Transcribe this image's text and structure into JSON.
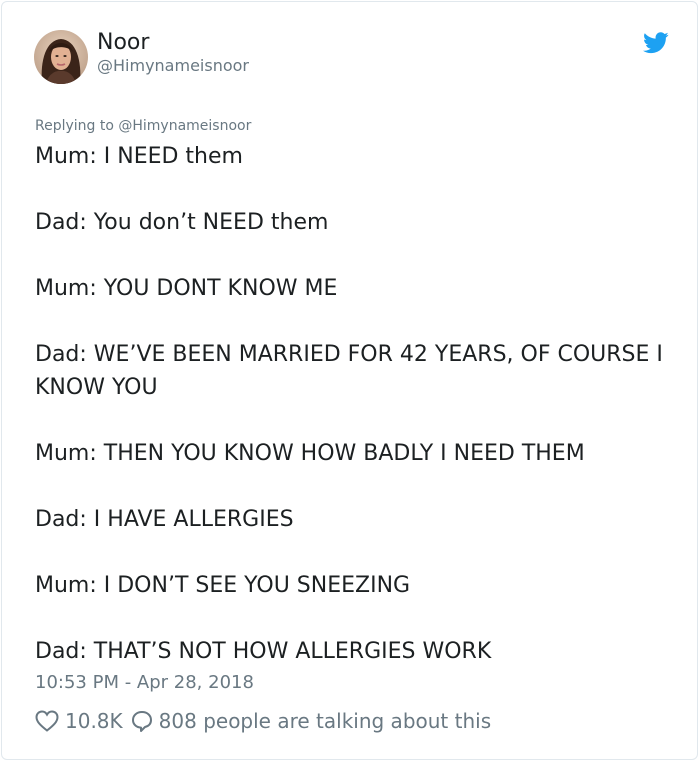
{
  "author": {
    "name": "Noor",
    "handle": "@Himynameisnoor"
  },
  "reply_prefix": "Replying to @Himynameisnoor",
  "tweet_lines": [
    "Mum: I NEED them",
    "Dad: You don’t NEED them",
    "Mum: YOU DONT KNOW ME",
    "Dad: WE’VE BEEN MARRIED FOR 42 YEARS, OF COURSE I KNOW YOU",
    "Mum: THEN YOU KNOW HOW BADLY I NEED THEM",
    "Dad: I HAVE ALLERGIES",
    "Mum: I DON’T SEE YOU SNEEZING",
    "Dad: THAT’S NOT HOW ALLERGIES WORK"
  ],
  "timestamp": "10:53 PM - Apr 28, 2018",
  "actions": {
    "likes": "10.8K",
    "talking": "808 people are talking about this"
  },
  "colors": {
    "brand": "#1da1f2",
    "text": "#1c2022",
    "muted": "#697882",
    "border": "#e1e8ed"
  },
  "icons": [
    "twitter-bird-icon",
    "heart-icon",
    "comment-bubble-icon"
  ]
}
